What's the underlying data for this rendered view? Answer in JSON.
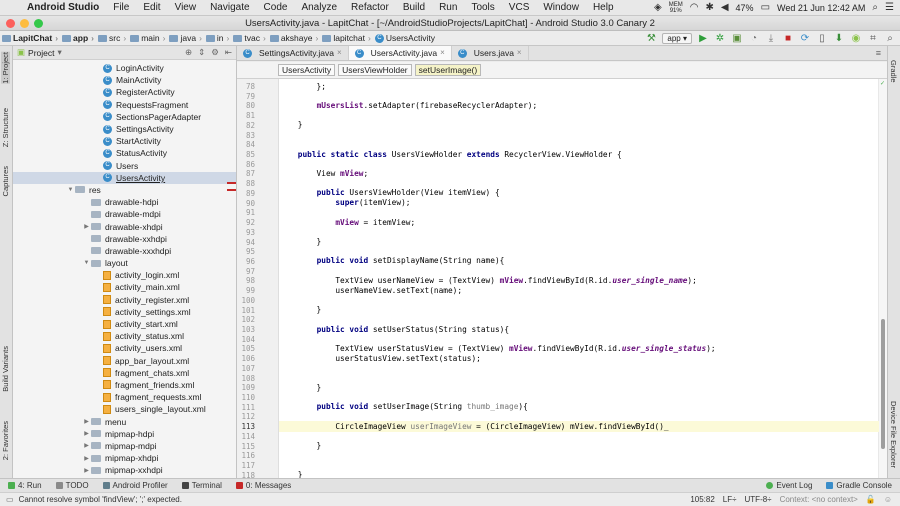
{
  "menubar": {
    "app_name": "Android Studio",
    "items": [
      "File",
      "Edit",
      "View",
      "Navigate",
      "Code",
      "Analyze",
      "Refactor",
      "Build",
      "Run",
      "Tools",
      "VCS",
      "Window",
      "Help"
    ],
    "mem_label": "MEM",
    "mem_value": "91%",
    "battery": "47%",
    "datetime": "Wed 21 Jun  12:42 AM"
  },
  "window_title": "UsersActivity.java - LapitChat - [~/AndroidStudioProjects/LapitChat] - Android Studio 3.0 Canary 2",
  "navbar": {
    "crumbs": [
      "LapitChat",
      "app",
      "src",
      "main",
      "java",
      "in",
      "tvac",
      "akshaye",
      "lapitchat",
      "UsersActivity"
    ],
    "run_config": "app"
  },
  "project_panel": {
    "title": "Project",
    "rows": [
      {
        "label": "LoginActivity",
        "kind": "class",
        "indent": 90
      },
      {
        "label": "MainActivity",
        "kind": "class",
        "indent": 90
      },
      {
        "label": "RegisterActivity",
        "kind": "class",
        "indent": 90
      },
      {
        "label": "RequestsFragment",
        "kind": "class",
        "indent": 90
      },
      {
        "label": "SectionsPagerAdapter",
        "kind": "class",
        "indent": 90
      },
      {
        "label": "SettingsActivity",
        "kind": "class",
        "indent": 90
      },
      {
        "label": "StartActivity",
        "kind": "class",
        "indent": 90
      },
      {
        "label": "StatusActivity",
        "kind": "class",
        "indent": 90
      },
      {
        "label": "Users",
        "kind": "class",
        "indent": 90
      },
      {
        "label": "UsersActivity",
        "kind": "class",
        "indent": 90,
        "selected": true
      },
      {
        "label": "res",
        "kind": "folder",
        "indent": 62,
        "arrow": "▼"
      },
      {
        "label": "drawable-hdpi",
        "kind": "folder",
        "indent": 78
      },
      {
        "label": "drawable-mdpi",
        "kind": "folder",
        "indent": 78
      },
      {
        "label": "drawable-xhdpi",
        "kind": "folder",
        "indent": 78,
        "arrow": "▶"
      },
      {
        "label": "drawable-xxhdpi",
        "kind": "folder",
        "indent": 78
      },
      {
        "label": "drawable-xxxhdpi",
        "kind": "folder",
        "indent": 78
      },
      {
        "label": "layout",
        "kind": "folder",
        "indent": 78,
        "arrow": "▼"
      },
      {
        "label": "activity_login.xml",
        "kind": "xml",
        "indent": 90
      },
      {
        "label": "activity_main.xml",
        "kind": "xml",
        "indent": 90
      },
      {
        "label": "activity_register.xml",
        "kind": "xml",
        "indent": 90
      },
      {
        "label": "activity_settings.xml",
        "kind": "xml",
        "indent": 90
      },
      {
        "label": "activity_start.xml",
        "kind": "xml",
        "indent": 90
      },
      {
        "label": "activity_status.xml",
        "kind": "xml",
        "indent": 90
      },
      {
        "label": "activity_users.xml",
        "kind": "xml",
        "indent": 90
      },
      {
        "label": "app_bar_layout.xml",
        "kind": "xml",
        "indent": 90
      },
      {
        "label": "fragment_chats.xml",
        "kind": "xml",
        "indent": 90
      },
      {
        "label": "fragment_friends.xml",
        "kind": "xml",
        "indent": 90
      },
      {
        "label": "fragment_requests.xml",
        "kind": "xml",
        "indent": 90
      },
      {
        "label": "users_single_layout.xml",
        "kind": "xml",
        "indent": 90
      },
      {
        "label": "menu",
        "kind": "folder",
        "indent": 78,
        "arrow": "▶"
      },
      {
        "label": "mipmap-hdpi",
        "kind": "folder",
        "indent": 78,
        "arrow": "▶"
      },
      {
        "label": "mipmap-mdpi",
        "kind": "folder",
        "indent": 78,
        "arrow": "▶"
      },
      {
        "label": "mipmap-xhdpi",
        "kind": "folder",
        "indent": 78,
        "arrow": "▶"
      },
      {
        "label": "mipmap-xxhdpi",
        "kind": "folder",
        "indent": 78,
        "arrow": "▶"
      }
    ]
  },
  "left_tools": [
    "1: Project",
    "Z: Structure",
    "Captures",
    "Build Variants",
    "2: Favorites"
  ],
  "right_tools": [
    "Gradle",
    "Device File Explorer"
  ],
  "tabs": [
    {
      "label": "SettingsActivity.java",
      "active": false
    },
    {
      "label": "UsersActivity.java",
      "active": true
    },
    {
      "label": "Users.java",
      "active": false
    }
  ],
  "tabs_overflow": "≡",
  "breadcrumb": [
    "UsersActivity",
    "UsersViewHolder",
    "setUserImage()"
  ],
  "code": [
    {
      "n": "78",
      "html": "        };"
    },
    {
      "n": "79",
      "html": ""
    },
    {
      "n": "80",
      "html": "        <span class='fd'>mUsersList</span>.setAdapter(firebaseRecyclerAdapter);"
    },
    {
      "n": "81",
      "html": ""
    },
    {
      "n": "82",
      "html": "    }"
    },
    {
      "n": "83",
      "html": ""
    },
    {
      "n": "84",
      "html": ""
    },
    {
      "n": "85",
      "html": "    <span class='kw'>public static class</span> UsersViewHolder <span class='kw'>extends</span> RecyclerView.ViewHolder {"
    },
    {
      "n": "86",
      "html": ""
    },
    {
      "n": "87",
      "html": "        View <span class='fd'>mView</span>;"
    },
    {
      "n": "88",
      "html": ""
    },
    {
      "n": "89",
      "html": "        <span class='kw'>public</span> UsersViewHolder(View itemView) {"
    },
    {
      "n": "90",
      "html": "            <span class='kw'>super</span>(itemView);"
    },
    {
      "n": "91",
      "html": ""
    },
    {
      "n": "92",
      "html": "            <span class='fd'>mView</span> = itemView;"
    },
    {
      "n": "93",
      "html": ""
    },
    {
      "n": "94",
      "html": "        }"
    },
    {
      "n": "95",
      "html": ""
    },
    {
      "n": "96",
      "html": "        <span class='kw'>public void</span> setDisplayName(String name){"
    },
    {
      "n": "97",
      "html": ""
    },
    {
      "n": "98",
      "html": "            TextView userNameView = (TextView) <span class='fd'>mView</span>.findViewById(R.id.<span class='it'>user_single_name</span>);"
    },
    {
      "n": "99",
      "html": "            userNameView.setText(name);"
    },
    {
      "n": "100",
      "html": ""
    },
    {
      "n": "101",
      "html": "        }"
    },
    {
      "n": "102",
      "html": ""
    },
    {
      "n": "103",
      "html": "        <span class='kw'>public void</span> setUserStatus(String status){"
    },
    {
      "n": "104",
      "html": ""
    },
    {
      "n": "105",
      "html": "            TextView userStatusView = (TextView) <span class='fd'>mView</span>.findViewById(R.id.<span class='it'>user_single_status</span>);"
    },
    {
      "n": "106",
      "html": "            userStatusView.setText(status);"
    },
    {
      "n": "107",
      "html": ""
    },
    {
      "n": "108",
      "html": ""
    },
    {
      "n": "109",
      "html": "        }"
    },
    {
      "n": "110",
      "html": ""
    },
    {
      "n": "111",
      "html": "        <span class='kw'>public void</span> setUserImage(String <span class='pm'>thumb_image</span>){"
    },
    {
      "n": "112",
      "html": ""
    },
    {
      "n": "113",
      "html": "            CircleImageView <span class='pm'>userImageView</span> = (CircleImageView) mView.findViewById()_",
      "current": true
    },
    {
      "n": "114",
      "html": ""
    },
    {
      "n": "115",
      "html": "        }"
    },
    {
      "n": "116",
      "html": ""
    },
    {
      "n": "117",
      "html": ""
    },
    {
      "n": "118",
      "html": "    }"
    }
  ],
  "bottom_tools": [
    "4: Run",
    "TODO",
    "Android Profiler",
    "Terminal",
    "0: Messages"
  ],
  "bottom_right_tools": [
    "Event Log",
    "Gradle Console"
  ],
  "status": {
    "message": "Cannot resolve symbol 'findView'; ';' expected.",
    "position": "105:82",
    "line_sep": "LF÷",
    "encoding": "UTF-8÷",
    "context": "Context: <no context>"
  }
}
